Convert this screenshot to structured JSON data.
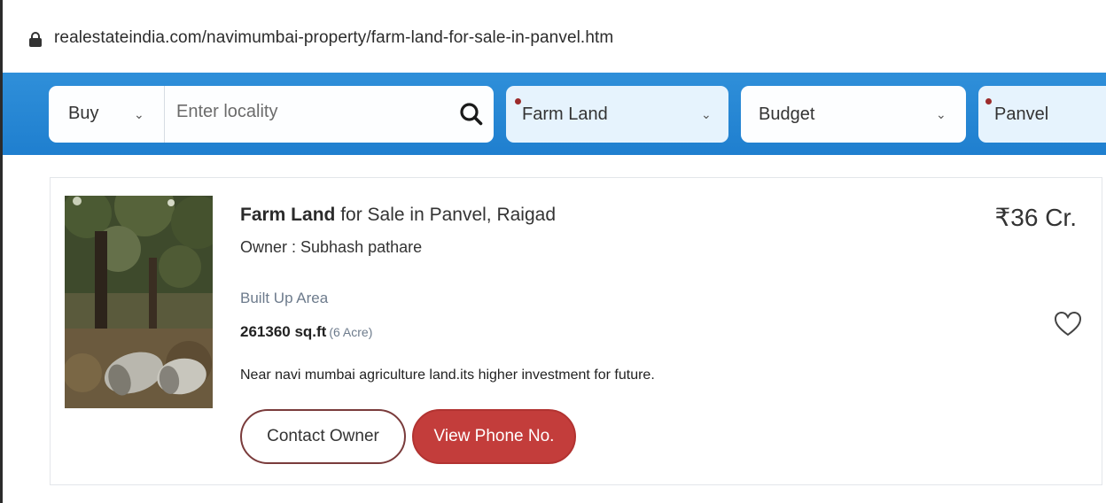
{
  "browser": {
    "url": "realestateindia.com/navimumbai-property/farm-land-for-sale-in-panvel.htm"
  },
  "search": {
    "buy_label": "Buy",
    "locality_placeholder": "Enter locality",
    "property_type": "Farm Land",
    "budget": "Budget",
    "city": "Panvel"
  },
  "listing": {
    "title_bold": "Farm Land",
    "title_rest": " for Sale in Panvel, Raigad",
    "owner": "Owner : Subhash pathare",
    "area_label": "Built Up Area",
    "area_value": "261360 sq.ft",
    "area_acre": "(6 Acre)",
    "description": "Near navi mumbai agriculture land.its higher investment for future.",
    "price": "₹36 Cr.",
    "contact_button": "Contact Owner",
    "phone_button": "View Phone No."
  },
  "colors": {
    "header_blue": "#2a88d6",
    "accent_red": "#c33d3b",
    "required_dot": "#9c2b2b"
  }
}
